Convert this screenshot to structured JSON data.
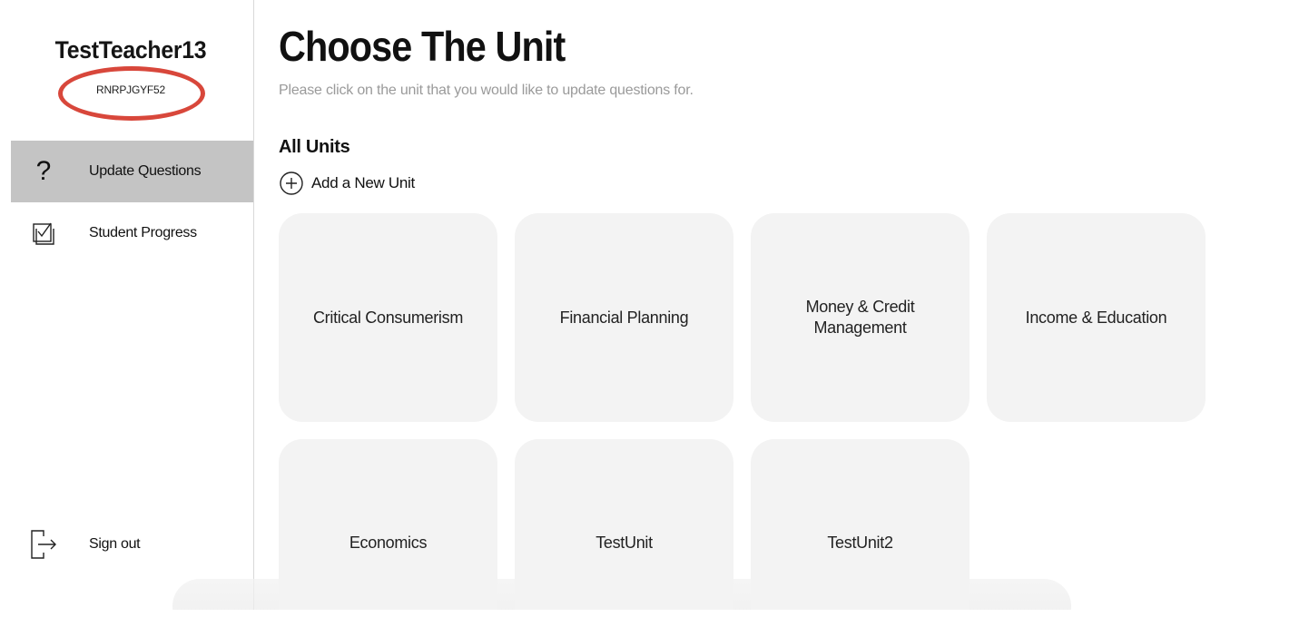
{
  "sidebar": {
    "teacher_name": "TestTeacher13",
    "teacher_code": "RNRPJGYF52",
    "nav": [
      {
        "label": "Update Questions",
        "icon": "question-mark-icon",
        "active": true
      },
      {
        "label": "Student Progress",
        "icon": "checkbox-icon",
        "active": false
      }
    ],
    "sign_out": {
      "label": "Sign out",
      "icon": "sign-out-icon"
    }
  },
  "main": {
    "title": "Choose The Unit",
    "subtitle": "Please click on the unit that you would like to update questions for.",
    "section_title": "All Units",
    "add_unit_label": "Add a New Unit",
    "units": [
      {
        "name": "Critical Consumerism"
      },
      {
        "name": "Financial Planning"
      },
      {
        "name": "Money & Credit Management"
      },
      {
        "name": "Income & Education"
      },
      {
        "name": "Economics"
      },
      {
        "name": "TestUnit"
      },
      {
        "name": "TestUnit2"
      }
    ]
  },
  "colors": {
    "highlight_circle": "#d8473b",
    "active_nav_bg": "#c4c4c4",
    "card_bg": "#f3f3f3",
    "subtitle_text": "#9a9a9a"
  }
}
